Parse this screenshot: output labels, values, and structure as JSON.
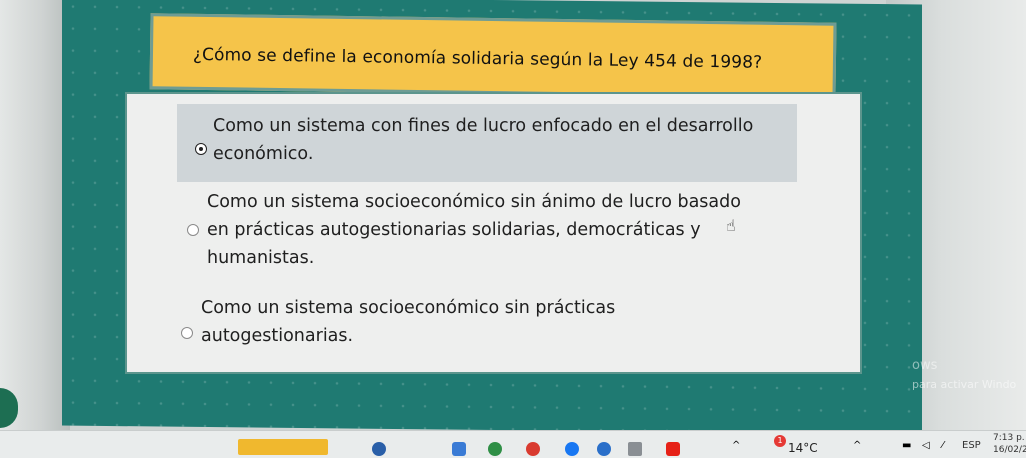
{
  "question": {
    "text": "¿Cómo se define la economía solidaria según la Ley 454 de 1998?"
  },
  "answers": [
    {
      "line1": "Como un sistema con fines de lucro enfocado en el desarrollo",
      "line2": "económico.",
      "selected": true
    },
    {
      "line1": "Como un sistema socioeconómico sin ánimo de lucro basado",
      "line2": "en prácticas autogestionarias solidarias, democráticas y",
      "line3": "humanistas.",
      "selected": false
    },
    {
      "line1": "Como un sistema socioeconómico sin prácticas",
      "line2": "autogestionarias.",
      "selected": false
    }
  ],
  "watermark": {
    "line1": "ows",
    "line2": "para activar Windo"
  },
  "taskbar": {
    "weather_badge": "1",
    "temperature": "14°C",
    "language": "ESP",
    "time": "7:13 p.",
    "date": "16/02/2"
  },
  "colors": {
    "question_bg": "#f5c44a",
    "panel_bg": "#1f7a72",
    "selected_answer_bg": "#cfd5d8"
  }
}
